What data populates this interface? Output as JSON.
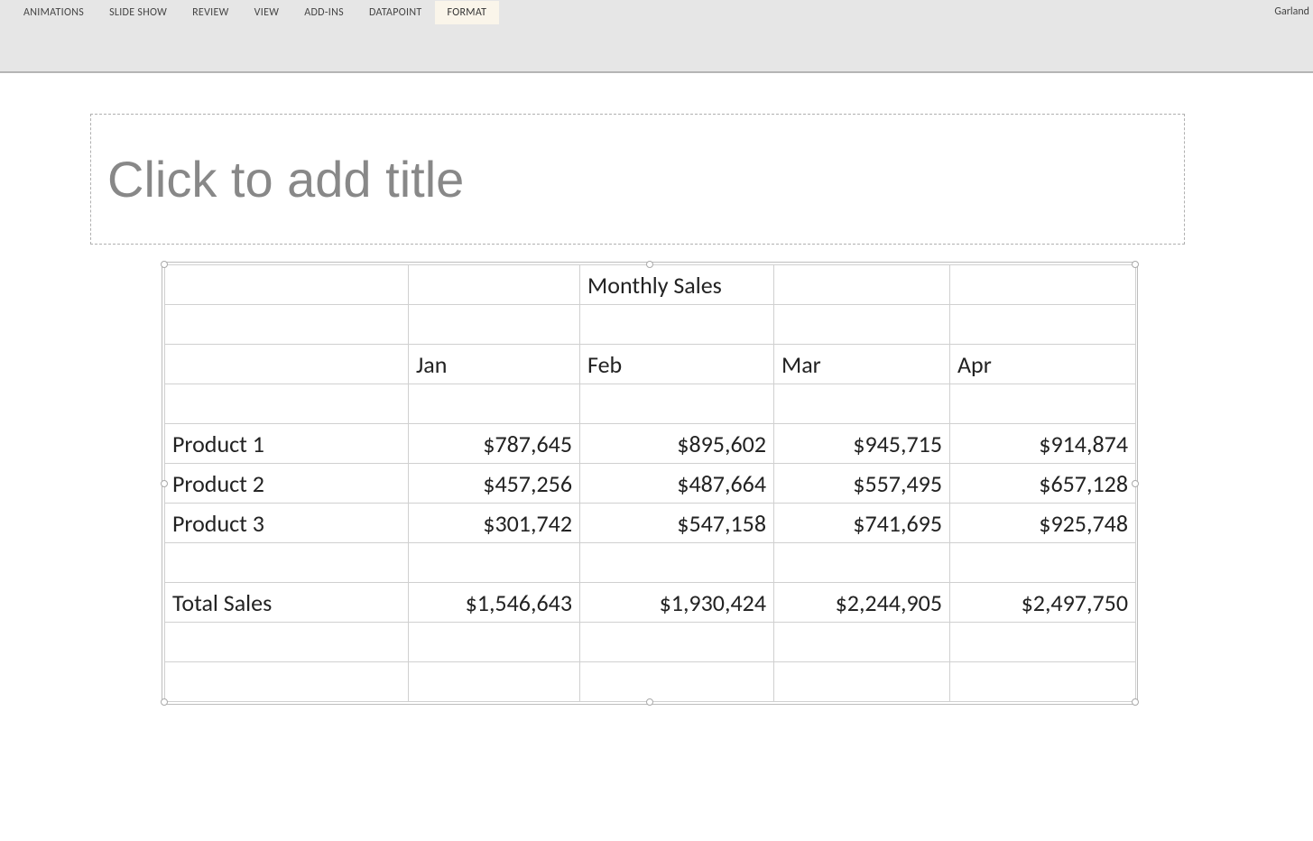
{
  "ribbon": {
    "tabs": [
      {
        "label": "ANIMATIONS",
        "active": false
      },
      {
        "label": "SLIDE SHOW",
        "active": false
      },
      {
        "label": "REVIEW",
        "active": false
      },
      {
        "label": "VIEW",
        "active": false
      },
      {
        "label": "ADD-INS",
        "active": false
      },
      {
        "label": "DATAPOINT",
        "active": false
      },
      {
        "label": "FORMAT",
        "active": true
      }
    ],
    "user": "Garland"
  },
  "slide": {
    "title_placeholder": "Click to add title",
    "table": {
      "heading": "Monthly Sales",
      "month_headers": [
        "Jan",
        "Feb",
        "Mar",
        "Apr"
      ],
      "rows": [
        {
          "label": "Product 1",
          "values": [
            "$787,645",
            "$895,602",
            "$945,715",
            "$914,874"
          ]
        },
        {
          "label": "Product 2",
          "values": [
            "$457,256",
            "$487,664",
            "$557,495",
            "$657,128"
          ]
        },
        {
          "label": "Product 3",
          "values": [
            "$301,742",
            "$547,158",
            "$741,695",
            "$925,748"
          ]
        }
      ],
      "total": {
        "label": "Total Sales",
        "values": [
          "$1,546,643",
          "$1,930,424",
          "$2,244,905",
          "$2,497,750"
        ]
      }
    }
  }
}
